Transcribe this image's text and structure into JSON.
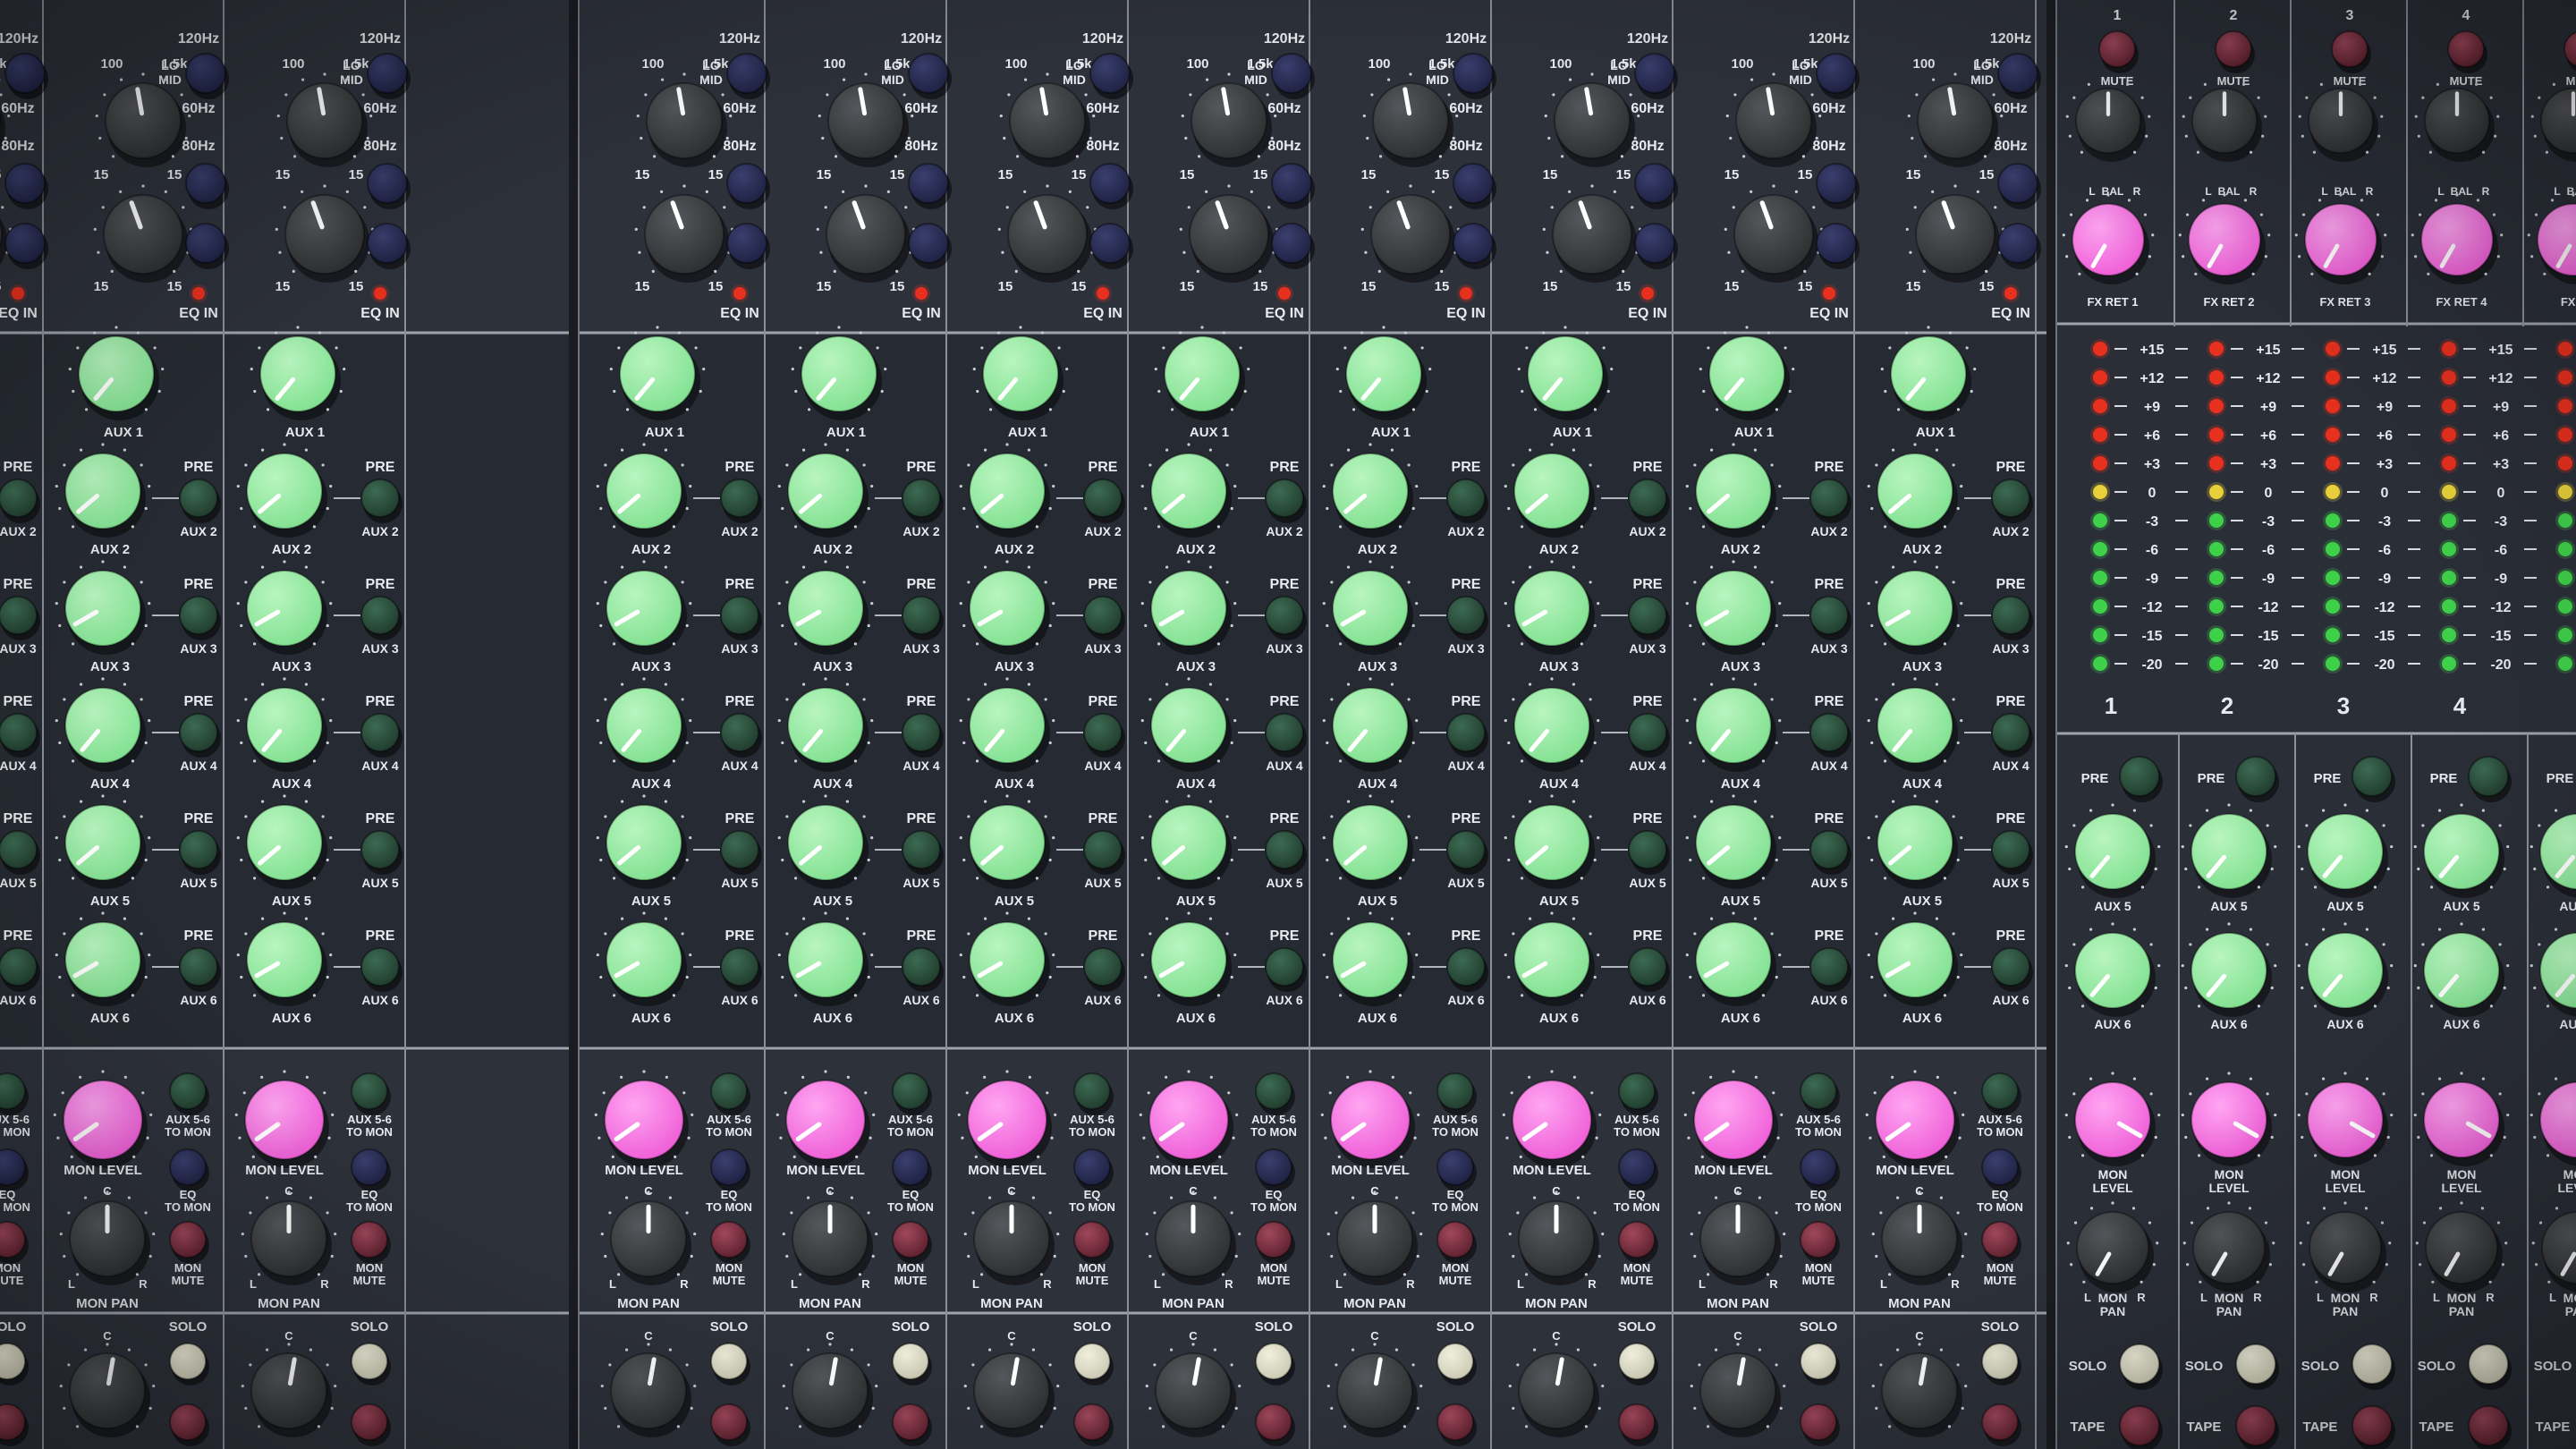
{
  "labels": {
    "freq_120": "120Hz",
    "freq_60": "60Hz",
    "freq_80": "80Hz",
    "freq_100": "100",
    "freq_1k5": "1.5k",
    "lo": "LO",
    "mid": "MID",
    "fifteen": "15",
    "zero": "0",
    "eq_in": "EQ IN",
    "aux1": "AUX 1",
    "aux2": "AUX 2",
    "aux3": "AUX 3",
    "aux4": "AUX 4",
    "aux5": "AUX 5",
    "aux6": "AUX 6",
    "pre": "PRE",
    "aux56_1": "AUX 5-6",
    "aux56_2": "TO MON",
    "mon_level": "MON LEVEL",
    "eq_mon_1": "EQ",
    "eq_mon_2": "TO MON",
    "mon_mute_1": "MON",
    "mon_mute_2": "MUTE",
    "mon_pan": "MON PAN",
    "pan_c": "C",
    "pan_l": "L",
    "pan_r": "R",
    "solo": "SOLO",
    "mute": "MUTE",
    "bal": "BAL",
    "tape": "TAPE",
    "mon": "MON",
    "level": "LEVEL",
    "pan": "PAN"
  },
  "fx_returns": [
    {
      "number": "1",
      "label": "FX RET 1"
    },
    {
      "number": "2",
      "label": "FX RET 2"
    },
    {
      "number": "3",
      "label": "FX RET 3"
    },
    {
      "number": "4",
      "label": "FX RET 4"
    },
    {
      "number": "",
      "label": "FX RE"
    }
  ],
  "meter_scale": [
    "+15",
    "+12",
    "+9",
    "+6",
    "+3",
    "0",
    "-3",
    "-6",
    "-9",
    "-12",
    "-15",
    "-20"
  ],
  "meter_numbers": [
    "1",
    "2",
    "3",
    "4"
  ],
  "colors": {
    "panel": "#2c3039",
    "aux_knob": "#7fe08f",
    "mon_knob": "#ee5bd6",
    "black_knob": "#2b2d2f",
    "navy_knob": "#1d2040",
    "dark_green_button": "#1f3a2c",
    "maroon_button": "#5a1f2c",
    "cream_button": "#c9c8b2",
    "led_red": "#e8301e",
    "led_yellow": "#e8d03a",
    "led_green": "#3fd04a"
  }
}
